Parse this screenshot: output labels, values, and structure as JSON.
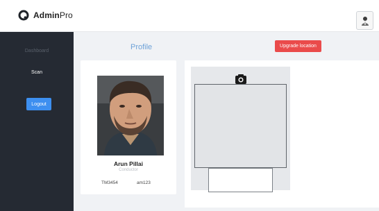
{
  "header": {
    "brand_bold": "Admin",
    "brand_light": "Pro"
  },
  "sidebar": {
    "items": [
      {
        "label": "Dashboard",
        "active": false
      },
      {
        "label": "Scan",
        "active": true
      }
    ],
    "logout_label": "Logout"
  },
  "main": {
    "profile_title": "Profile",
    "upgrade_label": "Upgrade location"
  },
  "profile": {
    "name": "Arun Pillai",
    "role": "Conductor",
    "id": "TM3454",
    "username": "am123"
  },
  "colors": {
    "sidebar_bg": "#252a33",
    "primary": "#3d8ff0",
    "danger": "#ea4b4b",
    "accent_text": "#6ea2d8"
  },
  "icons": {
    "brand": "admin-logo-icon",
    "user": "user-avatar-icon",
    "camera": "camera-icon"
  }
}
